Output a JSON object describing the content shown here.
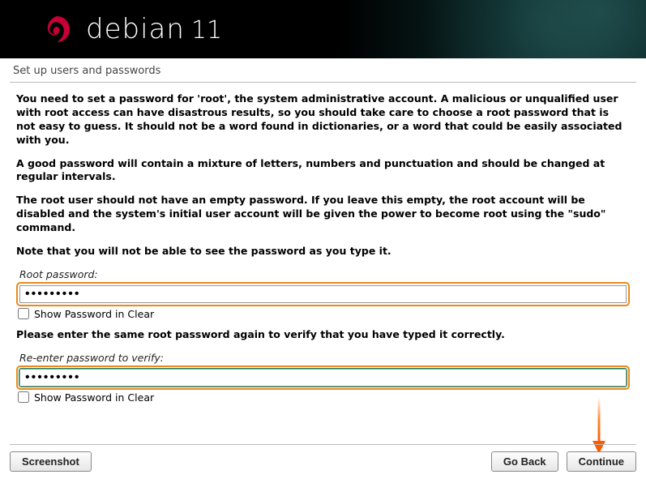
{
  "brand": {
    "name": "debian",
    "version": "11"
  },
  "step_title": "Set up users and passwords",
  "para1": "You need to set a password for 'root', the system administrative account. A malicious or unqualified user with root access can have disastrous results, so you should take care to choose a root password that is not easy to guess. It should not be a word found in dictionaries, or a word that could be easily associated with you.",
  "para2": "A good password will contain a mixture of letters, numbers and punctuation and should be changed at regular intervals.",
  "para3": "The root user should not have an empty password. If you leave this empty, the root account will be disabled and the system's initial user account will be given the power to become root using the \"sudo\" command.",
  "para4": "Note that you will not be able to see the password as you type it.",
  "label_root_pw": "Root password:",
  "show_clear": "Show Password in Clear",
  "para5": "Please enter the same root password again to verify that you have typed it correctly.",
  "label_verify": "Re-enter password to verify:",
  "root_pw_value": "•••••••••",
  "verify_pw_value": "•••••••••",
  "buttons": {
    "screenshot": "Screenshot",
    "goback": "Go Back",
    "continue": "Continue"
  }
}
